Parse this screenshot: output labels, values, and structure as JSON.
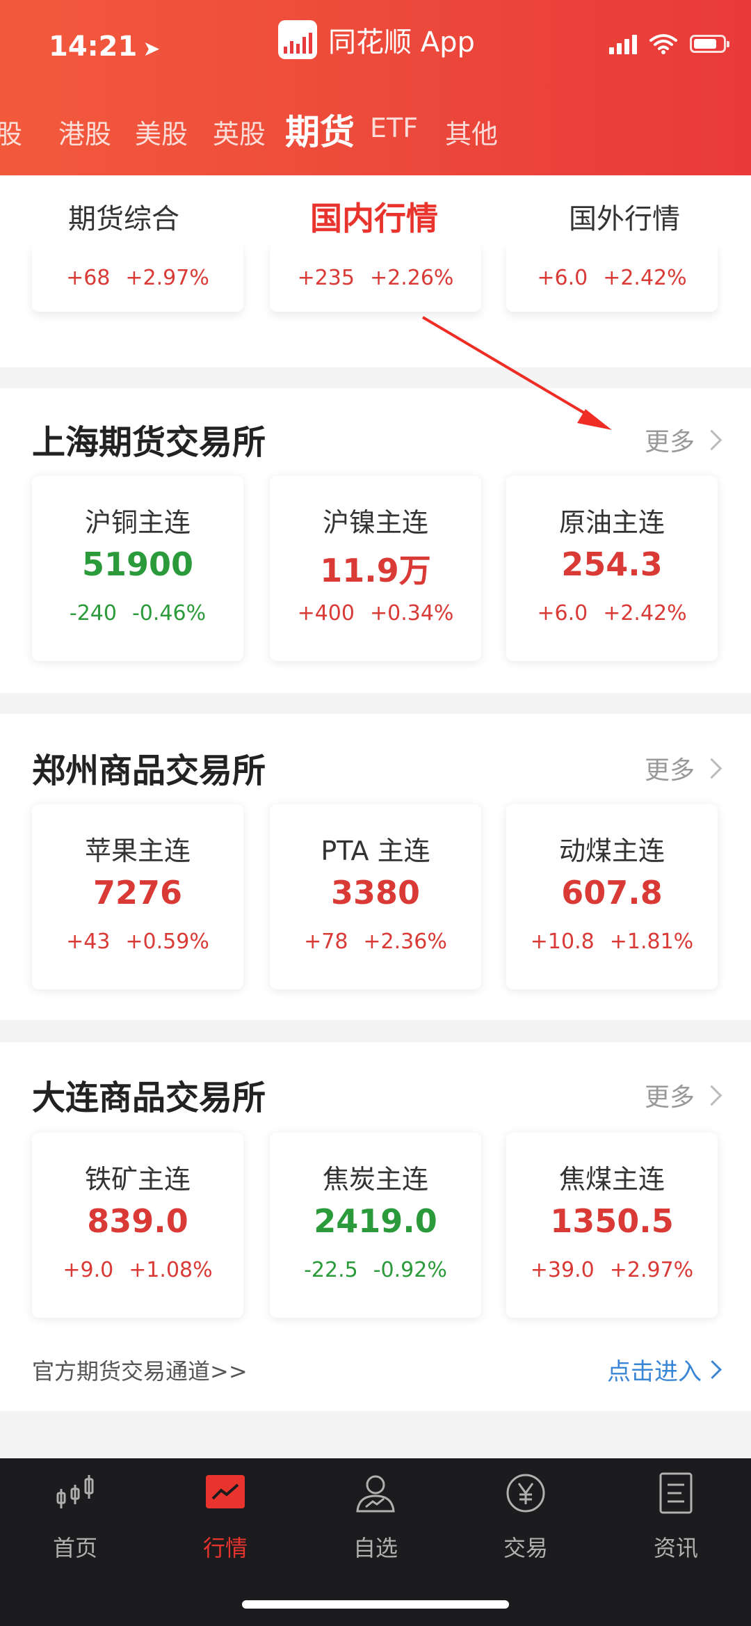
{
  "status": {
    "time": "14:21"
  },
  "app": {
    "title": "同花顺 App"
  },
  "market_tabs": [
    "股",
    "港股",
    "美股",
    "英股",
    "期货",
    "ETF",
    "其他"
  ],
  "active_market_tab": "期货",
  "sub_tabs": [
    "期货综合",
    "国内行情",
    "国外行情"
  ],
  "active_sub_tab": "国内行情",
  "top_partial": [
    {
      "change": "+68",
      "pct": "+2.97%"
    },
    {
      "change": "+235",
      "pct": "+2.26%"
    },
    {
      "change": "+6.0",
      "pct": "+2.42%"
    }
  ],
  "sections": [
    {
      "title": "上海期货交易所",
      "more": "更多",
      "cards": [
        {
          "name": "沪铜主连",
          "price": "51900",
          "change": "-240",
          "pct": "-0.46%",
          "dir": "down"
        },
        {
          "name": "沪镍主连",
          "price": "11.9万",
          "change": "+400",
          "pct": "+0.34%",
          "dir": "up"
        },
        {
          "name": "原油主连",
          "price": "254.3",
          "change": "+6.0",
          "pct": "+2.42%",
          "dir": "up"
        }
      ]
    },
    {
      "title": "郑州商品交易所",
      "more": "更多",
      "cards": [
        {
          "name": "苹果主连",
          "price": "7276",
          "change": "+43",
          "pct": "+0.59%",
          "dir": "up"
        },
        {
          "name": "PTA 主连",
          "price": "3380",
          "change": "+78",
          "pct": "+2.36%",
          "dir": "up"
        },
        {
          "name": "动煤主连",
          "price": "607.8",
          "change": "+10.8",
          "pct": "+1.81%",
          "dir": "up"
        }
      ]
    },
    {
      "title": "大连商品交易所",
      "more": "更多",
      "cards": [
        {
          "name": "铁矿主连",
          "price": "839.0",
          "change": "+9.0",
          "pct": "+1.08%",
          "dir": "up"
        },
        {
          "name": "焦炭主连",
          "price": "2419.0",
          "change": "-22.5",
          "pct": "-0.92%",
          "dir": "down"
        },
        {
          "name": "焦煤主连",
          "price": "1350.5",
          "change": "+39.0",
          "pct": "+2.97%",
          "dir": "up"
        }
      ]
    }
  ],
  "footer": {
    "link_text": "官方期货交易通道>>",
    "enter_text": "点击进入"
  },
  "bottom_nav": [
    {
      "label": "首页",
      "icon": "candlestick-icon"
    },
    {
      "label": "行情",
      "icon": "chart-icon"
    },
    {
      "label": "自选",
      "icon": "person-icon"
    },
    {
      "label": "交易",
      "icon": "yen-coin-icon"
    },
    {
      "label": "资讯",
      "icon": "document-icon"
    }
  ],
  "active_bottom_nav": "行情",
  "colors": {
    "up": "#d93a36",
    "down": "#2a9a3a",
    "accent": "#e8342d",
    "header": "#ec4436"
  }
}
